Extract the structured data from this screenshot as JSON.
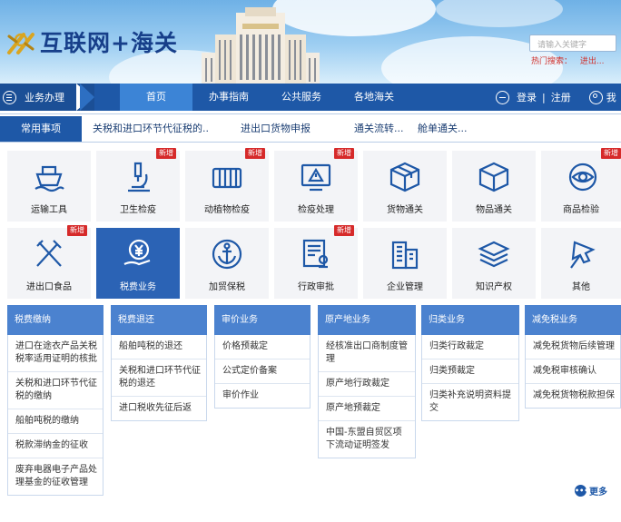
{
  "header": {
    "logo_text": "互联网+海关",
    "search_placeholder": "请输入关键字",
    "hot_label": "热门搜索：",
    "hot_item": "进出..."
  },
  "nav": {
    "business_menu": "业务办理",
    "items": [
      "首页",
      "办事指南",
      "公共服务",
      "各地海关"
    ],
    "login": "登录",
    "separator": "|",
    "register": "注册",
    "me": "我"
  },
  "subbar": {
    "tab": "常用事项",
    "links": [
      "关税和进口环节代征税的..",
      "进出口货物申报",
      "通关流转...",
      "舱单通关..."
    ]
  },
  "tiles": [
    {
      "label": "运输工具",
      "icon": "ship-icon",
      "badge": ""
    },
    {
      "label": "卫生检疫",
      "icon": "microscope-icon",
      "badge": "新增"
    },
    {
      "label": "动植物检疫",
      "icon": "grid-bars-icon",
      "badge": "新增"
    },
    {
      "label": "检疫处理",
      "icon": "warning-monitor-icon",
      "badge": "新增"
    },
    {
      "label": "货物通关",
      "icon": "box-icon",
      "badge": ""
    },
    {
      "label": "物品通关",
      "icon": "cube-icon",
      "badge": ""
    },
    {
      "label": "商品检验",
      "icon": "eye-icon",
      "badge": "新增"
    },
    {
      "label": "进出口食品",
      "icon": "cutlery-icon",
      "badge": "新增"
    },
    {
      "label": "税费业务",
      "icon": "yuan-hand-icon",
      "badge": ""
    },
    {
      "label": "加贸保税",
      "icon": "anchor-icon",
      "badge": ""
    },
    {
      "label": "行政审批",
      "icon": "document-stamp-icon",
      "badge": "新增"
    },
    {
      "label": "企业管理",
      "icon": "building-icon",
      "badge": ""
    },
    {
      "label": "知识产权",
      "icon": "stack-icon",
      "badge": ""
    },
    {
      "label": "其他",
      "icon": "pin-icon",
      "badge": ""
    }
  ],
  "columns": [
    {
      "title": "税费缴纳",
      "items": [
        "进口在途衣产品关税税率适用证明的核批",
        "关税和进口环节代征税的缴纳",
        "船舶吨税的缴纳",
        "税款滞纳金的征收",
        "废弃电器电子产品处理基金的征收管理"
      ]
    },
    {
      "title": "税费退还",
      "items": [
        "船舶吨税的退还",
        "关税和进口环节代征税的退还",
        "进口税收先征后返"
      ]
    },
    {
      "title": "审价业务",
      "items": [
        "价格预裁定",
        "公式定价备案",
        "审价作业"
      ]
    },
    {
      "title": "原产地业务",
      "items": [
        "经核准出口商制度管理",
        "原产地行政裁定",
        "原产地预裁定",
        "中国-东盟自贸区项下流动证明签发"
      ]
    },
    {
      "title": "归类业务",
      "items": [
        "归类行政裁定",
        "归类预裁定",
        "归类补充说明资料提交"
      ]
    },
    {
      "title": "减免税业务",
      "items": [
        "减免税货物后续管理",
        "减免税审核确认",
        "减免税货物税款担保"
      ]
    }
  ],
  "more_label": "更多",
  "colors": {
    "nav_blue": "#1e58a7",
    "tile_selected": "#2b63b5",
    "column_header": "#4b82cf",
    "badge_red": "#d62a2a"
  }
}
